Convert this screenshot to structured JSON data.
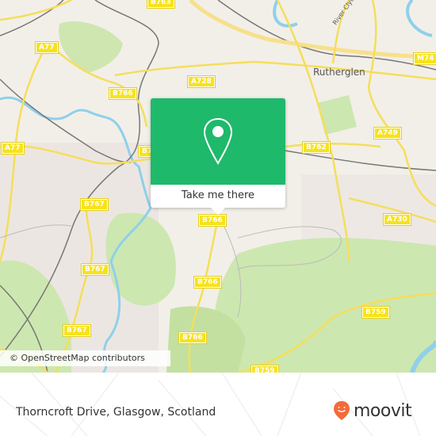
{
  "map": {
    "place_labels": [
      {
        "name": "Rutherglen"
      }
    ],
    "river_label": "River Clyde",
    "road_shields": [
      "B763",
      "A77",
      "A728",
      "B766",
      "A77",
      "B7",
      "M74",
      "A749",
      "B762",
      "B767",
      "B767",
      "B767",
      "B766",
      "B766",
      "A730",
      "B759",
      "B766",
      "B759",
      "B766"
    ],
    "attribution": "© OpenStreetMap contributors",
    "colors": {
      "land": "#f2efe9",
      "park": "#c8e6a7",
      "water": "#8fd0ea",
      "road_major": "#f5de5a",
      "shield": "#f7e21c"
    }
  },
  "popup": {
    "icon": "map-pin-icon",
    "button_label": "Take me there",
    "color": "#1fb96b"
  },
  "footer": {
    "address": "Thorncroft Drive, Glasgow, Scotland",
    "logo_text": "moovit",
    "logo_color": "#f26b3a"
  }
}
